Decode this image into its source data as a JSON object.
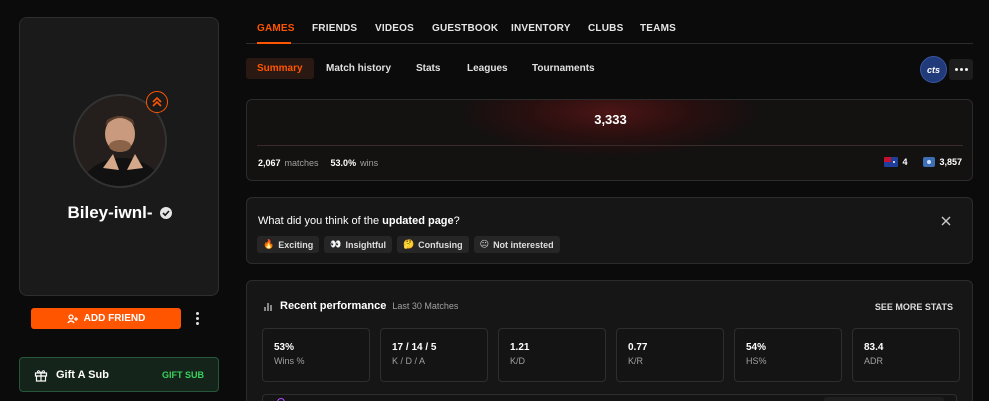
{
  "profile": {
    "nickname": "Biley-iwnl-",
    "add_friend_label": "ADD FRIEND"
  },
  "gift": {
    "label": "Gift A Sub",
    "button": "GIFT SUB"
  },
  "nav": {
    "tabs": [
      "GAMES",
      "FRIENDS",
      "VIDEOS",
      "GUESTBOOK",
      "INVENTORY",
      "CLUBS",
      "TEAMS"
    ],
    "active_tab": "GAMES"
  },
  "subnav": {
    "tabs": [
      "Summary",
      "Match history",
      "Stats",
      "Leagues",
      "Tournaments"
    ],
    "active_tab": "Summary"
  },
  "team_logo_text": "cts",
  "elo": {
    "value": "3,333",
    "matches_value": "2,067",
    "matches_label": "matches",
    "winrate_value": "53.0%",
    "winrate_label": "wins",
    "country_rank": "4",
    "region_rank": "3,857"
  },
  "feedback": {
    "question_prefix": "What did you think of the ",
    "question_bold": "updated page",
    "question_suffix": "?",
    "options": [
      {
        "emoji": "🔥",
        "label": "Exciting"
      },
      {
        "emoji": "👀",
        "label": "Insightful"
      },
      {
        "emoji": "🤔",
        "label": "Confusing"
      },
      {
        "emoji": "😐",
        "label": "Not interested"
      }
    ]
  },
  "performance": {
    "title": "Recent performance",
    "subtitle": "Last 30 Matches",
    "see_more": "SEE MORE STATS",
    "stats": [
      {
        "value": "53%",
        "label": "Wins %"
      },
      {
        "value": "17 / 14 / 5",
        "label": "K / D / A"
      },
      {
        "value": "1.21",
        "label": "K/D"
      },
      {
        "value": "0.77",
        "label": "K/R"
      },
      {
        "value": "54%",
        "label": "HS%"
      },
      {
        "value": "83.4",
        "label": "ADR"
      }
    ]
  },
  "colors": {
    "accent": "#ff5500",
    "gift_green": "#39d15d",
    "background": "#0b0b0b"
  }
}
